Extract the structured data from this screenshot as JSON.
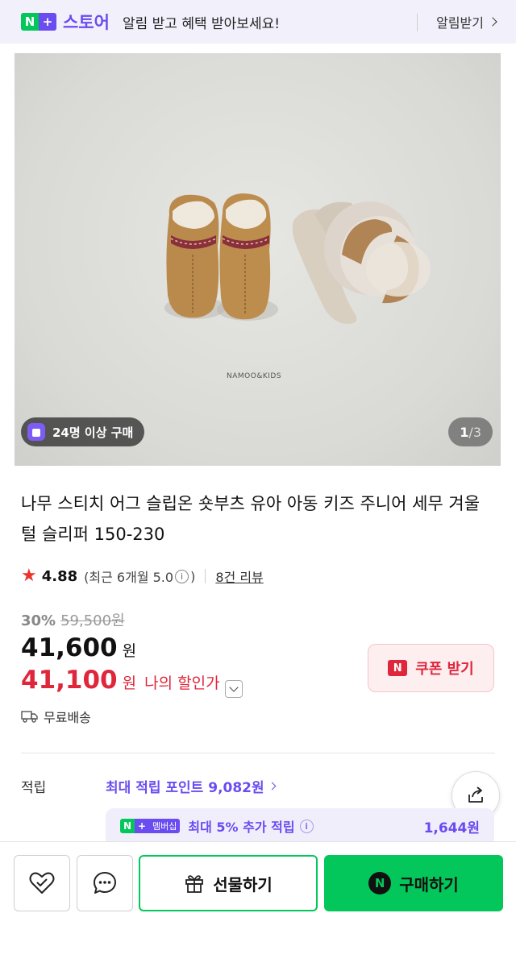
{
  "banner": {
    "badge_n": "N",
    "badge_plus": "+",
    "store_name": "스토어",
    "message": "알림 받고 혜택 받아보세요!",
    "link_label": "알림받기"
  },
  "photo": {
    "watermark": "NAMOO&KIDS",
    "buyers_badge": "24명 이상 구매",
    "page_current": "1",
    "page_total": "/3"
  },
  "product": {
    "title": "나무 스티치 어그 슬립온 숏부츠 유아 아동 키즈 주니어 세무 겨울 털 슬리퍼 150-230"
  },
  "rating": {
    "star": "★",
    "score": "4.88",
    "recent_open": "(최근 6개월 5.0",
    "info": "i",
    "recent_close": ")",
    "reviews_link": "8건 리뷰"
  },
  "price": {
    "discount_rate": "30%",
    "original": "59,500원",
    "sale": "41,600",
    "unit": "원",
    "my_price": "41,100",
    "my_price_unit": "원",
    "my_price_label": "나의 할인가"
  },
  "coupon": {
    "badge": "N",
    "label": "쿠폰 받기"
  },
  "delivery": {
    "label": "무료배송"
  },
  "points": {
    "label": "적립",
    "max_label": "최대 적립 포인트 9,082원",
    "member_badge_n": "N",
    "member_badge_plus": "+",
    "member_badge_text": "멤버십",
    "member_text": "최대 5% 추가 적립",
    "member_info": "i",
    "member_amount": "1,644원"
  },
  "bottom": {
    "gift_label": "선물하기",
    "buy_badge": "N",
    "buy_label": "구매하기"
  },
  "colors": {
    "brand_green": "#03c75a",
    "brand_purple": "#6a4cf0",
    "sale_red": "#e0263a"
  },
  "icons": [
    "heart-check-icon",
    "chat-icon",
    "gift-icon",
    "share-icon",
    "truck-icon",
    "star-icon",
    "shopping-bag-icon"
  ]
}
